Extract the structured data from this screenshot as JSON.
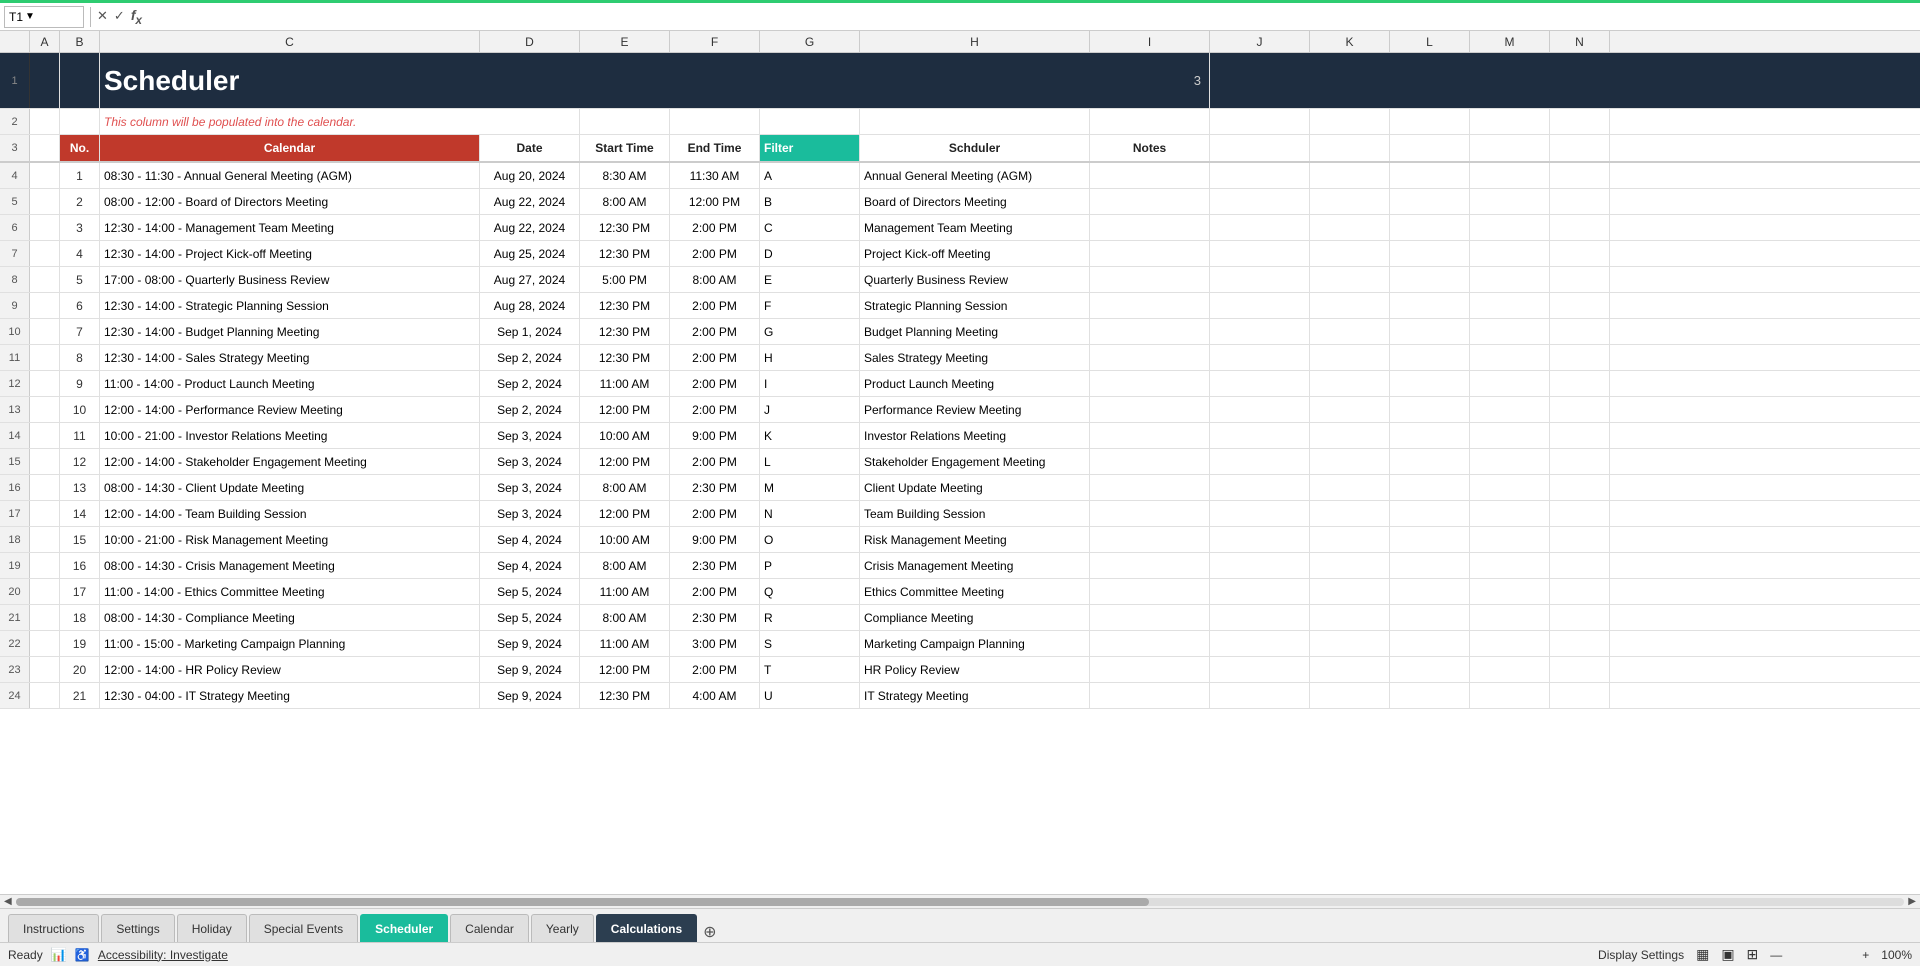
{
  "app": {
    "cell_ref": "T1",
    "formula_bar_value": "",
    "green_bar_color": "#2ecc71"
  },
  "columns": [
    {
      "label": "",
      "class": "col-a",
      "key": "a"
    },
    {
      "label": "A",
      "class": "col-a",
      "key": "a"
    },
    {
      "label": "B",
      "class": "col-b",
      "key": "b"
    },
    {
      "label": "C",
      "class": "col-c",
      "key": "c"
    },
    {
      "label": "D",
      "class": "col-d",
      "key": "d"
    },
    {
      "label": "E",
      "class": "col-e",
      "key": "e"
    },
    {
      "label": "F",
      "class": "col-f",
      "key": "f"
    },
    {
      "label": "G",
      "class": "col-g",
      "key": "g"
    },
    {
      "label": "H",
      "class": "col-h",
      "key": "h"
    },
    {
      "label": "I",
      "class": "col-i",
      "key": "i"
    },
    {
      "label": "J",
      "class": "col-j",
      "key": "j"
    },
    {
      "label": "K",
      "class": "col-k",
      "key": "k"
    },
    {
      "label": "L",
      "class": "col-l",
      "key": "l"
    },
    {
      "label": "M",
      "class": "col-m",
      "key": "m"
    },
    {
      "label": "N",
      "class": "col-n",
      "key": "n"
    }
  ],
  "title": "Scheduler",
  "title_side_value": "3",
  "subtitle": "This column will be populated into the calendar.",
  "header": {
    "no": "No.",
    "calendar": "Calendar",
    "date": "Date",
    "start_time": "Start Time",
    "end_time": "End Time",
    "filter": "Filter",
    "scheduler": "Schduler",
    "notes": "Notes"
  },
  "rows": [
    {
      "no": 1,
      "calendar": "08:30 - 11:30 - Annual General Meeting (AGM)",
      "date": "Aug 20, 2024",
      "start": "8:30 AM",
      "end": "11:30 AM",
      "filter": "A",
      "scheduler": "Annual General Meeting (AGM)",
      "notes": ""
    },
    {
      "no": 2,
      "calendar": "08:00 - 12:00 - Board of Directors Meeting",
      "date": "Aug 22, 2024",
      "start": "8:00 AM",
      "end": "12:00 PM",
      "filter": "B",
      "scheduler": "Board of Directors Meeting",
      "notes": ""
    },
    {
      "no": 3,
      "calendar": "12:30 - 14:00 - Management Team Meeting",
      "date": "Aug 22, 2024",
      "start": "12:30 PM",
      "end": "2:00 PM",
      "filter": "C",
      "scheduler": "Management Team Meeting",
      "notes": ""
    },
    {
      "no": 4,
      "calendar": "12:30 - 14:00 - Project Kick-off Meeting",
      "date": "Aug 25, 2024",
      "start": "12:30 PM",
      "end": "2:00 PM",
      "filter": "D",
      "scheduler": "Project Kick-off Meeting",
      "notes": ""
    },
    {
      "no": 5,
      "calendar": "17:00 - 08:00 - Quarterly Business Review",
      "date": "Aug 27, 2024",
      "start": "5:00 PM",
      "end": "8:00 AM",
      "filter": "E",
      "scheduler": "Quarterly Business Review",
      "notes": ""
    },
    {
      "no": 6,
      "calendar": "12:30 - 14:00 - Strategic Planning Session",
      "date": "Aug 28, 2024",
      "start": "12:30 PM",
      "end": "2:00 PM",
      "filter": "F",
      "scheduler": "Strategic Planning Session",
      "notes": ""
    },
    {
      "no": 7,
      "calendar": "12:30 - 14:00 - Budget Planning Meeting",
      "date": "Sep 1, 2024",
      "start": "12:30 PM",
      "end": "2:00 PM",
      "filter": "G",
      "scheduler": "Budget Planning Meeting",
      "notes": ""
    },
    {
      "no": 8,
      "calendar": "12:30 - 14:00 - Sales Strategy Meeting",
      "date": "Sep 2, 2024",
      "start": "12:30 PM",
      "end": "2:00 PM",
      "filter": "H",
      "scheduler": "Sales Strategy Meeting",
      "notes": ""
    },
    {
      "no": 9,
      "calendar": "11:00 - 14:00 - Product Launch Meeting",
      "date": "Sep 2, 2024",
      "start": "11:00 AM",
      "end": "2:00 PM",
      "filter": "I",
      "scheduler": "Product Launch Meeting",
      "notes": ""
    },
    {
      "no": 10,
      "calendar": "12:00 - 14:00 - Performance Review Meeting",
      "date": "Sep 2, 2024",
      "start": "12:00 PM",
      "end": "2:00 PM",
      "filter": "J",
      "scheduler": "Performance Review Meeting",
      "notes": ""
    },
    {
      "no": 11,
      "calendar": "10:00 - 21:00 - Investor Relations Meeting",
      "date": "Sep 3, 2024",
      "start": "10:00 AM",
      "end": "9:00 PM",
      "filter": "K",
      "scheduler": "Investor Relations Meeting",
      "notes": ""
    },
    {
      "no": 12,
      "calendar": "12:00 - 14:00 - Stakeholder Engagement Meeting",
      "date": "Sep 3, 2024",
      "start": "12:00 PM",
      "end": "2:00 PM",
      "filter": "L",
      "scheduler": "Stakeholder Engagement Meeting",
      "notes": ""
    },
    {
      "no": 13,
      "calendar": "08:00 - 14:30 - Client Update Meeting",
      "date": "Sep 3, 2024",
      "start": "8:00 AM",
      "end": "2:30 PM",
      "filter": "M",
      "scheduler": "Client Update Meeting",
      "notes": ""
    },
    {
      "no": 14,
      "calendar": "12:00 - 14:00 - Team Building Session",
      "date": "Sep 3, 2024",
      "start": "12:00 PM",
      "end": "2:00 PM",
      "filter": "N",
      "scheduler": "Team Building Session",
      "notes": ""
    },
    {
      "no": 15,
      "calendar": "10:00 - 21:00 - Risk Management Meeting",
      "date": "Sep 4, 2024",
      "start": "10:00 AM",
      "end": "9:00 PM",
      "filter": "O",
      "scheduler": "Risk Management Meeting",
      "notes": ""
    },
    {
      "no": 16,
      "calendar": "08:00 - 14:30 - Crisis Management Meeting",
      "date": "Sep 4, 2024",
      "start": "8:00 AM",
      "end": "2:30 PM",
      "filter": "P",
      "scheduler": "Crisis Management Meeting",
      "notes": ""
    },
    {
      "no": 17,
      "calendar": "11:00 - 14:00 - Ethics Committee Meeting",
      "date": "Sep 5, 2024",
      "start": "11:00 AM",
      "end": "2:00 PM",
      "filter": "Q",
      "scheduler": "Ethics Committee Meeting",
      "notes": ""
    },
    {
      "no": 18,
      "calendar": "08:00 - 14:30 - Compliance Meeting",
      "date": "Sep 5, 2024",
      "start": "8:00 AM",
      "end": "2:30 PM",
      "filter": "R",
      "scheduler": "Compliance Meeting",
      "notes": ""
    },
    {
      "no": 19,
      "calendar": "11:00 - 15:00 - Marketing Campaign Planning",
      "date": "Sep 9, 2024",
      "start": "11:00 AM",
      "end": "3:00 PM",
      "filter": "S",
      "scheduler": "Marketing Campaign Planning",
      "notes": ""
    },
    {
      "no": 20,
      "calendar": "12:00 - 14:00 - HR Policy Review",
      "date": "Sep 9, 2024",
      "start": "12:00 PM",
      "end": "2:00 PM",
      "filter": "T",
      "scheduler": "HR Policy Review",
      "notes": ""
    },
    {
      "no": 21,
      "calendar": "12:30 - 04:00 - IT Strategy Meeting",
      "date": "Sep 9, 2024",
      "start": "12:30 PM",
      "end": "4:00 AM",
      "filter": "U",
      "scheduler": "IT Strategy Meeting",
      "notes": ""
    }
  ],
  "tabs": [
    {
      "label": "Instructions",
      "active": false
    },
    {
      "label": "Settings",
      "active": false
    },
    {
      "label": "Holiday",
      "active": false
    },
    {
      "label": "Special Events",
      "active": false
    },
    {
      "label": "Scheduler",
      "active": true,
      "style": "teal"
    },
    {
      "label": "Calendar",
      "active": false
    },
    {
      "label": "Yearly",
      "active": false
    },
    {
      "label": "Calculations",
      "active": true,
      "style": "dark"
    }
  ],
  "status": {
    "ready": "Ready",
    "accessibility": "Accessibility: Investigate",
    "display_settings": "Display Settings",
    "zoom": "100%"
  }
}
